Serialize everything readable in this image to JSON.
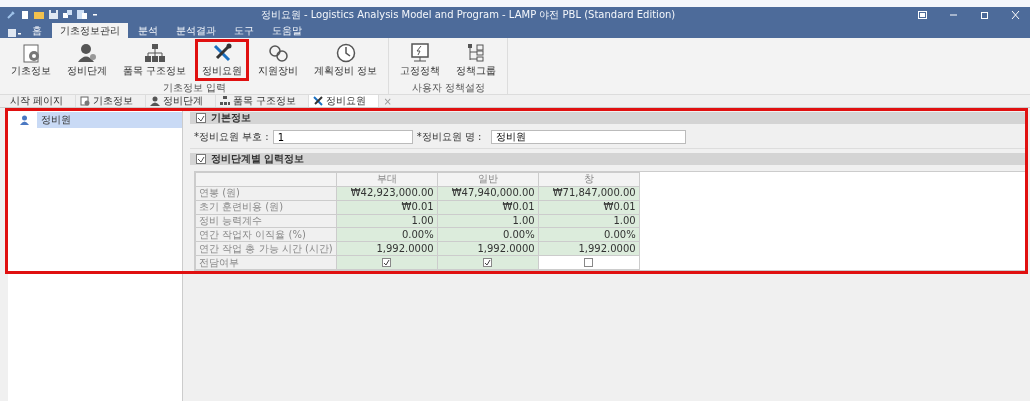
{
  "window": {
    "title": "정비요원 - Logistics Analysis Model and Program - LAMP 야전 PBL (Standard Edition)"
  },
  "menu_tabs": [
    {
      "label": "홈",
      "selected": false
    },
    {
      "label": "기초정보관리",
      "selected": true
    },
    {
      "label": "분석",
      "selected": false
    },
    {
      "label": "분석결과",
      "selected": false
    },
    {
      "label": "도구",
      "selected": false
    },
    {
      "label": "도움말",
      "selected": false
    }
  ],
  "ribbon": {
    "groups": [
      {
        "label": "기초정보 입력",
        "buttons": [
          {
            "label": "기초정보",
            "highlighted": false
          },
          {
            "label": "정비단계",
            "highlighted": false
          },
          {
            "label": "품목 구조정보",
            "highlighted": false
          },
          {
            "label": "정비요원",
            "highlighted": true
          },
          {
            "label": "지원장비",
            "highlighted": false
          },
          {
            "label": "계획정비 정보",
            "highlighted": false
          }
        ]
      },
      {
        "label": "사용자 정책설정",
        "buttons": [
          {
            "label": "고정정책",
            "highlighted": false
          },
          {
            "label": "정책그룹",
            "highlighted": false
          }
        ]
      }
    ]
  },
  "doc_tabs": [
    {
      "label": "시작 페이지",
      "selected": false
    },
    {
      "label": "기초정보",
      "selected": false
    },
    {
      "label": "정비단계",
      "selected": false
    },
    {
      "label": "품목 구조정보",
      "selected": false
    },
    {
      "label": "정비요원",
      "selected": true,
      "close": "×"
    }
  ],
  "workspace": {
    "highlighted": true
  },
  "tree": [
    {
      "label": "정비원",
      "selected": true
    }
  ],
  "basic_info": {
    "title": "기본정보",
    "fields": [
      {
        "label": "*정비요원 부호 :",
        "value": "1"
      },
      {
        "label": "*정비요원 명 :",
        "value": "정비원"
      }
    ]
  },
  "stage_info": {
    "title": "정비단계별 입력정보",
    "table": {
      "columns": [
        "부대",
        "일반",
        "창"
      ],
      "rows": [
        {
          "label": "연봉 (원)",
          "kind": "text",
          "cells": [
            "₩42,923,000.00",
            "₩47,940,000.00",
            "₩71,847,000.00"
          ]
        },
        {
          "label": "초기 훈련비용 (원)",
          "kind": "text",
          "cells": [
            "₩0.01",
            "₩0.01",
            "₩0.01"
          ]
        },
        {
          "label": "정비 능력계수",
          "kind": "text",
          "cells": [
            "1.00",
            "1.00",
            "1.00"
          ]
        },
        {
          "label": "연간 작업자 이직율 (%)",
          "kind": "text",
          "cells": [
            "0.00%",
            "0.00%",
            "0.00%"
          ]
        },
        {
          "label": "연간 작업 총 가능 시간 (시간)",
          "kind": "text",
          "cells": [
            "1,992.0000",
            "1,992.0000",
            "1,992.0000"
          ]
        },
        {
          "label": "전담여부",
          "kind": "checkbox",
          "cells": [
            {
              "checked": true
            },
            {
              "checked": true
            },
            {
              "checked": false
            }
          ]
        }
      ]
    }
  }
}
